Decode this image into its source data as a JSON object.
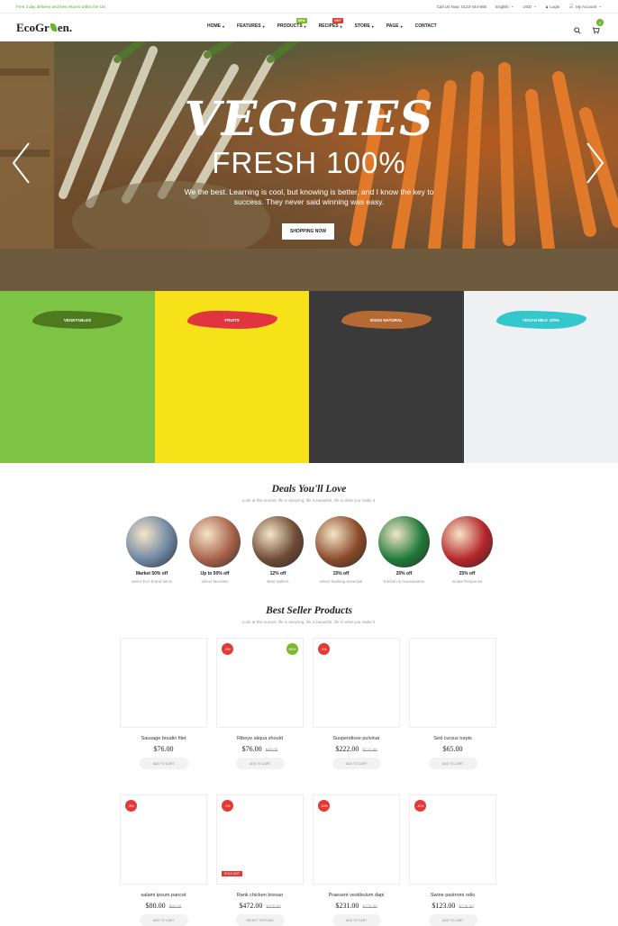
{
  "topbar": {
    "promo": "Free 3 day delivery and free returns within the US",
    "call": "Call Us Now: 0123-444-666",
    "language": "English",
    "currency": "USD",
    "login": "Login",
    "account": "My Account"
  },
  "header": {
    "logo_left": "EcoGr",
    "logo_right": "en.",
    "nav": [
      {
        "label": "HOME",
        "badge": ""
      },
      {
        "label": "FEATURES",
        "badge": ""
      },
      {
        "label": "PRODUCTS",
        "badge": "NEW",
        "badge_color": "#7cb82f"
      },
      {
        "label": "RECIPES",
        "badge": "HOT",
        "badge_color": "#e53935"
      },
      {
        "label": "STORE",
        "badge": ""
      },
      {
        "label": "PAGE",
        "badge": ""
      },
      {
        "label": "CONTACT",
        "badge": ""
      }
    ],
    "cart_count": "0"
  },
  "hero": {
    "title": "VEGGIES",
    "subtitle": "FRESH 100%",
    "description": "We the best. Learning is cool, but knowing is better, and I know the key to success. They never said winning was easy.",
    "button": "SHOPPING NOW"
  },
  "categories": [
    {
      "label": "VEGETABLES",
      "brush": "#4d7a1f",
      "bg": "#7dc444"
    },
    {
      "label": "FRUITS",
      "brush": "#e0353f",
      "bg": "#f7e21a"
    },
    {
      "label": "EGGS NATURAL",
      "brush": "#b56a33",
      "bg": "#3a3a3a"
    },
    {
      "label": "VEGAN MILK 100%",
      "brush": "#34c7cc",
      "bg": "#eef0f2"
    }
  ],
  "deals": {
    "title": "Deals You'll Love",
    "subtitle": "Look at this sunset, life is amazing, life is beautiful, life is what you make it.",
    "items": [
      {
        "title": "Market 50% off",
        "sub": "select Eco brand items",
        "color": "#6f86a3"
      },
      {
        "title": "Up to 50% off",
        "sub": "select favorites",
        "color": "#a8614a"
      },
      {
        "title": "12% off",
        "sub": "Best Sellers",
        "color": "#6e4a35"
      },
      {
        "title": "15% off",
        "sub": "select banking essential",
        "color": "#8a4a28"
      },
      {
        "title": "20% off",
        "sub": "Kitchen & Housewares",
        "color": "#1f7a3a"
      },
      {
        "title": "25% off",
        "sub": "Innate Response",
        "color": "#b5252a"
      }
    ]
  },
  "bestseller": {
    "title": "Best Seller Products",
    "subtitle": "Look at this sunset, life is amazing, life is beautiful, life is what you make it.",
    "products": [
      {
        "name": "Sausage boudin filet",
        "price": "$76.00",
        "old": "",
        "sale": "",
        "new": "",
        "soldout": "",
        "button": "ADD TO CART",
        "art": "lemon"
      },
      {
        "name": "Ribeye aliqua should",
        "price": "$76.00",
        "old": "$80.00",
        "sale": "-5%",
        "new": "NEW",
        "soldout": "",
        "button": "ADD TO CART",
        "art": "broccoli"
      },
      {
        "name": "Suspendisse pulvinar",
        "price": "$222.00",
        "old": "$232.00",
        "sale": "-4%",
        "new": "",
        "soldout": "",
        "button": "ADD TO CART",
        "art": "spinach"
      },
      {
        "name": "Sed cursus turpis",
        "price": "$65.00",
        "old": "",
        "sale": "",
        "new": "",
        "soldout": "",
        "button": "ADD TO CART",
        "art": "sack"
      },
      {
        "name": "salami ipsum pancet",
        "price": "$80.00",
        "old": "$86.00",
        "sale": "-8%",
        "new": "",
        "soldout": "",
        "button": "ADD TO CART",
        "art": "meat"
      },
      {
        "name": "Rank chicken bresao",
        "price": "$472.00",
        "old": "$476.00",
        "sale": "-1%",
        "new": "",
        "soldout": "SOLD OUT",
        "button": "SELECT OPTIONS",
        "art": "eggs"
      },
      {
        "name": "Praesent vestibulum dapi",
        "price": "$231.00",
        "old": "$256.00",
        "sale": "-10%",
        "new": "",
        "soldout": "",
        "button": "ADD TO CART",
        "art": "pepper"
      },
      {
        "name": "Swine pastromi odio",
        "price": "$123.00",
        "old": "$136.00",
        "sale": "-10%",
        "new": "",
        "soldout": "",
        "button": "ADD TO CART",
        "art": "beef"
      }
    ]
  }
}
